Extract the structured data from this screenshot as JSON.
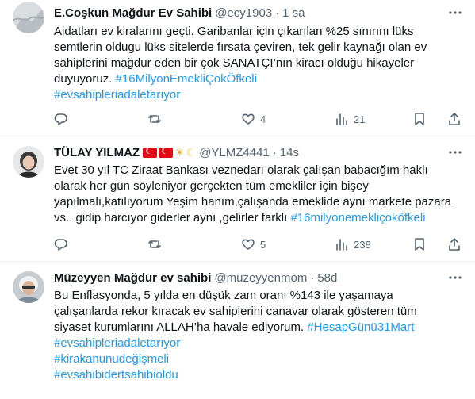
{
  "tweets": [
    {
      "name": "E.Coşkun Mağdur Ev Sahibi",
      "handle": "@ecy1903",
      "time": "1 sa",
      "lines": [
        [
          {
            "t": "Aidatları ev kiralarını geçti. Garibanlar için çıkarılan %25 sınırını lüks"
          }
        ],
        [
          {
            "t": "semtlerin oldugu lüks sitelerde fırsata çeviren, tek gelir kaynağı olan ev"
          }
        ],
        [
          {
            "t": "sahiplerini mağdur eden  bir çok SANATÇI’nın kiracı olduğu hikayeler"
          }
        ],
        [
          {
            "t": "duyuyoruz. "
          },
          {
            "t": "#16MilyonEmekliÇokÖfkeli",
            "tag": true
          }
        ],
        [
          {
            "t": "#evsahipleriadaletarıyor",
            "tag": true
          }
        ]
      ],
      "actions": {
        "reply": "",
        "retweet": "",
        "like": "4",
        "views": "21"
      }
    },
    {
      "name": "TÜLAY YILMAZ",
      "handle": "@YLMZ4441",
      "time": "14s",
      "lines": [
        [
          {
            "t": "Evet 30 yıl TC Ziraat Bankası veznedarı olarak çalışan babacığım haklı"
          }
        ],
        [
          {
            "t": "olarak her gün söyleniyor gerçekten tüm emekliler için bişey"
          }
        ],
        [
          {
            "t": "yapılmalı,katılıyorum Yeşim hanım,çalışanda emeklide aynı markete pazara"
          }
        ],
        [
          {
            "t": "vs.. gidip harcıyor giderler aynı ,gelirler farklı "
          },
          {
            "t": "#16milyonemekliçoköfkeli",
            "tag": true
          }
        ]
      ],
      "actions": {
        "reply": "",
        "retweet": "",
        "like": "5",
        "views": "238"
      }
    },
    {
      "name": "Müzeyyen Mağdur ev sahibi",
      "handle": "@muzeyyenmom",
      "time": "58d",
      "lines": [
        [
          {
            "t": "Bu Enflasyonda, 5 yılda en düşük zam oranı %143 ile yaşamaya"
          }
        ],
        [
          {
            "t": "çalışanlarda rekor kıracak  ev sahiplerini canavar olarak gösteren  tüm"
          }
        ],
        [
          {
            "t": "siyaset kurumlarını ALLAH’ha havale ediyorum. "
          },
          {
            "t": "#HesapGünü31Mart",
            "tag": true
          }
        ],
        [
          {
            "t": "#evsahipleriadaletarıyor",
            "tag": true
          }
        ],
        [
          {
            "t": "#kirakanunudeğişmeli",
            "tag": true
          }
        ],
        [
          {
            "t": "#evsahibidertsahibioldu",
            "tag": true
          }
        ]
      ]
    }
  ],
  "icons": {
    "more": "more-horizontal-icon",
    "reply": "reply-icon",
    "retweet": "retweet-icon",
    "like": "heart-icon",
    "views": "views-chart-icon",
    "bookmark": "bookmark-icon",
    "share": "share-icon",
    "flags": [
      "turkish-flag-icon",
      "turkish-flag-icon",
      "sun-icon",
      "crescent-moon-icon"
    ]
  },
  "colors": {
    "text": "#0f1419",
    "muted": "#536471",
    "link": "#1d9bf0",
    "divider": "#eff3f4"
  }
}
